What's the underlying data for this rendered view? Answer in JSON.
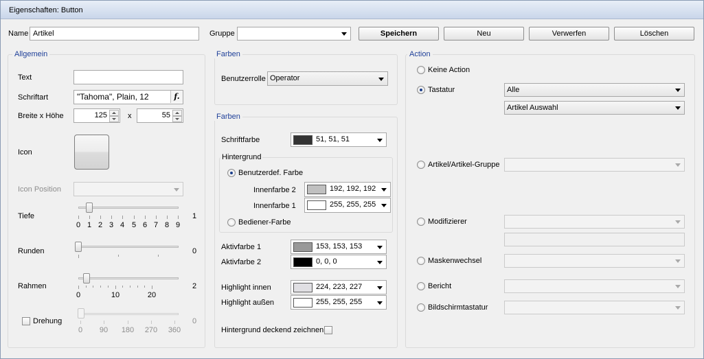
{
  "window": {
    "title": "Eigenschaften: Button"
  },
  "top": {
    "name_label": "Name",
    "name_value": "Artikel",
    "group_label": "Gruppe",
    "group_value": "",
    "buttons": {
      "save": "Speichern",
      "new": "Neu",
      "discard": "Verwerfen",
      "delete": "Löschen"
    }
  },
  "allgemein": {
    "title": "Allgemein",
    "text_label": "Text",
    "text_value": "",
    "font_label": "Schriftart",
    "font_value": "\"Tahoma\", Plain, 12",
    "font_button": "f.",
    "size_label": "Breite x Höhe",
    "width": "125",
    "x": "x",
    "height": "55",
    "icon_label": "Icon",
    "icon_position_label": "Icon Position",
    "icon_position_value": "",
    "depth": {
      "label": "Tiefe",
      "ticks": [
        "0",
        "1",
        "2",
        "3",
        "4",
        "5",
        "6",
        "7",
        "8",
        "9"
      ],
      "value": "1"
    },
    "rounding": {
      "label": "Runden",
      "value": "0"
    },
    "frame": {
      "label": "Rahmen",
      "ticks": [
        "0",
        "10",
        "20"
      ],
      "value": "2"
    },
    "rotation": {
      "label": "Drehung",
      "ticks": [
        "0",
        "90",
        "180",
        "270",
        "360"
      ],
      "value": "0",
      "checked": false
    }
  },
  "farben1": {
    "title": "Farben",
    "role_label": "Benutzerrolle",
    "role_value": "Operator"
  },
  "farben2": {
    "title": "Farben",
    "font_color_label": "Schriftfarbe",
    "font_color": {
      "text": "51, 51, 51",
      "hex": "#333333"
    },
    "background_title": "Hintergrund",
    "custom_color_label": "Benutzerdef. Farbe",
    "inner2_label": "Innenfarbe 2",
    "inner2": {
      "text": "192, 192, 192",
      "hex": "#c0c0c0"
    },
    "inner1_label": "Innenfarbe 1",
    "inner1": {
      "text": "255, 255, 255",
      "hex": "#ffffff"
    },
    "operator_color_label": "Bediener-Farbe",
    "active1_label": "Aktivfarbe 1",
    "active1": {
      "text": "153, 153, 153",
      "hex": "#999999"
    },
    "active2_label": "Aktivfarbe 2",
    "active2": {
      "text": "0, 0, 0",
      "hex": "#000000"
    },
    "highlight_inner_label": "Highlight innen",
    "highlight_inner": {
      "text": "224, 223, 227",
      "hex": "#e0dfe3"
    },
    "highlight_outer_label": "Highlight außen",
    "highlight_outer": {
      "text": "255, 255, 255",
      "hex": "#ffffff"
    },
    "opaque_label": "Hintergrund deckend zeichnen"
  },
  "action": {
    "title": "Action",
    "none_label": "Keine Action",
    "keyboard_label": "Tastatur",
    "keyboard_value1": "Alle",
    "keyboard_value2": "Artikel Auswahl",
    "article_group_label": "Artikel/Artikel-Gruppe",
    "modifier_label": "Modifizierer",
    "mask_change_label": "Maskenwechsel",
    "report_label": "Bericht",
    "screen_keyboard_label": "Bildschirmtastatur"
  }
}
